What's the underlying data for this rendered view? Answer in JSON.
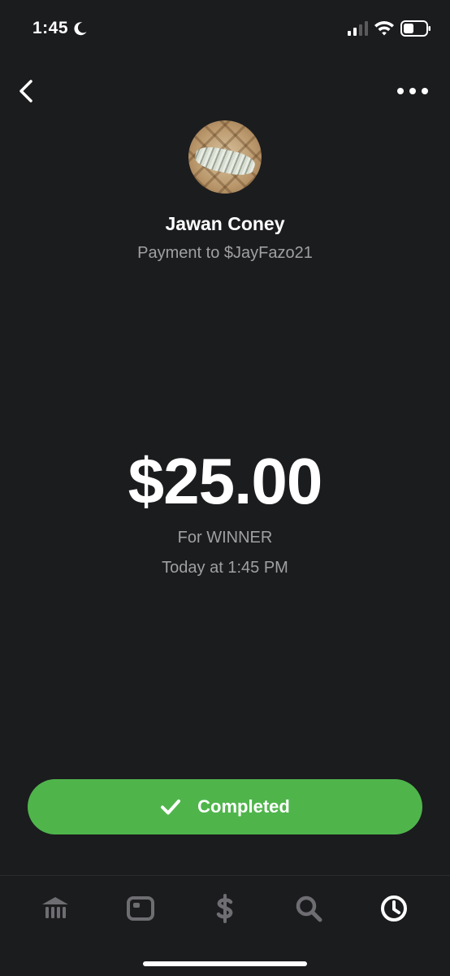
{
  "status_bar": {
    "time": "1:45",
    "icons": [
      "moon-icon",
      "cellular-signal-icon",
      "wifi-icon",
      "battery-icon"
    ]
  },
  "nav": {
    "back_icon": "chevron-left-icon",
    "more_icon": "more-horizontal-icon"
  },
  "recipient": {
    "name": "Jawan Coney",
    "subtitle": "Payment to $JayFazo21"
  },
  "payment": {
    "amount": "$25.00",
    "note": "For WINNER",
    "timestamp": "Today at 1:45 PM"
  },
  "status": {
    "label": "Completed",
    "icon": "check-icon",
    "color": "#4fb54b"
  },
  "tabs": [
    {
      "icon": "bank-icon",
      "active": false
    },
    {
      "icon": "card-icon",
      "active": false
    },
    {
      "icon": "dollar-icon",
      "active": false
    },
    {
      "icon": "search-icon",
      "active": false
    },
    {
      "icon": "clock-icon",
      "active": true
    }
  ],
  "colors": {
    "background": "#1b1c1e",
    "text_primary": "#ffffff",
    "text_secondary": "#a0a0a3",
    "tab_inactive": "#6e6e72",
    "tab_active": "#ffffff"
  }
}
